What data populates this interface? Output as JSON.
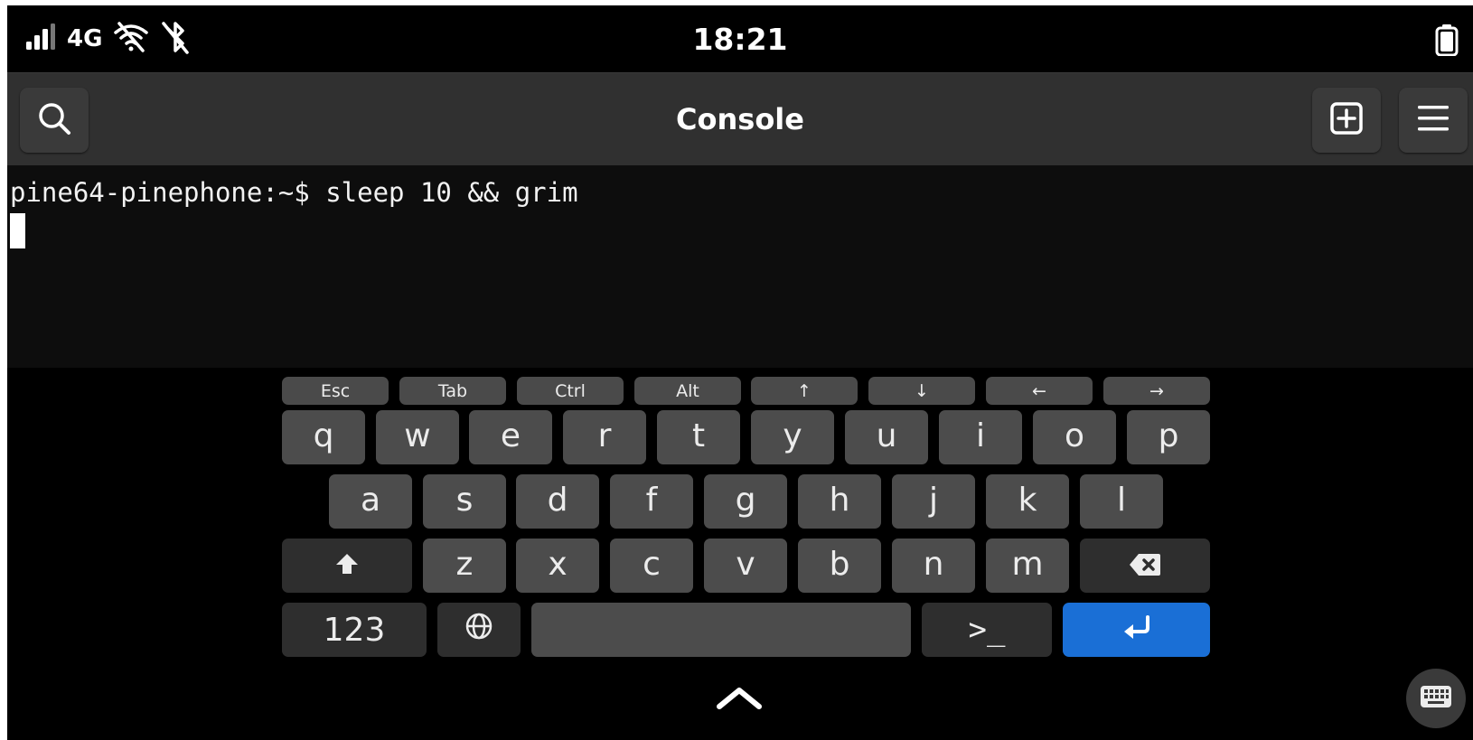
{
  "status_bar": {
    "network": "4G",
    "clock": "18:21",
    "icons": [
      "signal-icon",
      "wifi-off-icon",
      "bluetooth-off-icon",
      "battery-icon"
    ]
  },
  "header": {
    "title": "Console",
    "buttons": [
      "search-icon",
      "new-tab-icon",
      "menu-icon"
    ]
  },
  "terminal": {
    "prompt_line": "pine64-pinephone:~$ sleep 10 && grim"
  },
  "keyboard": {
    "extra_row": [
      "Esc",
      "Tab",
      "Ctrl",
      "Alt",
      "↑",
      "↓",
      "←",
      "→"
    ],
    "row1": [
      "q",
      "w",
      "e",
      "r",
      "t",
      "y",
      "u",
      "i",
      "o",
      "p"
    ],
    "row2": [
      "a",
      "s",
      "d",
      "f",
      "g",
      "h",
      "j",
      "k",
      "l"
    ],
    "row3": [
      "z",
      "x",
      "c",
      "v",
      "b",
      "n",
      "m"
    ],
    "numbers_key": "123",
    "terminal_key": ">_",
    "colors": {
      "enter": "#1a6fd6",
      "key": "#4c4c4c",
      "mod_key": "#2e2e2e"
    }
  }
}
